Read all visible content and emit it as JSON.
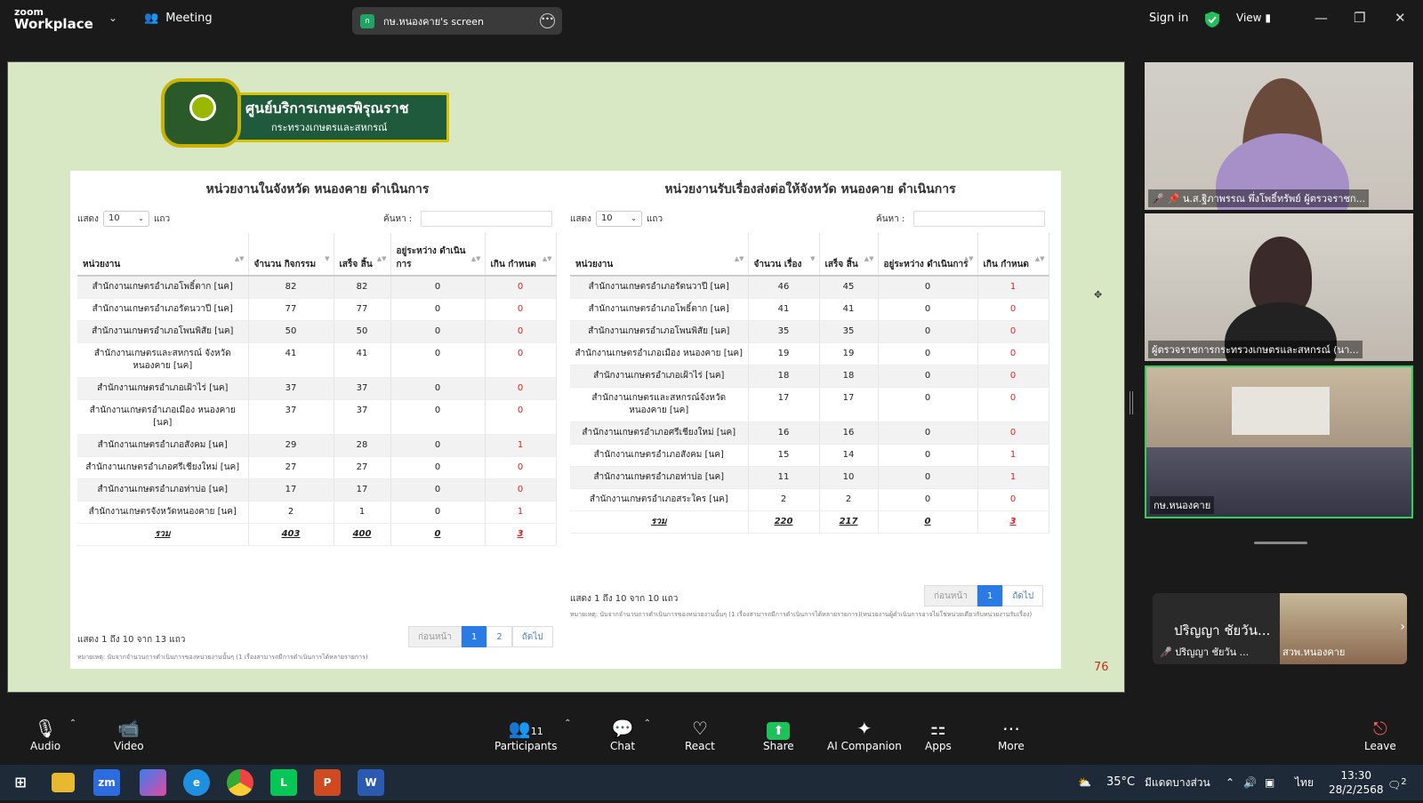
{
  "topbar": {
    "logo_top": "zoom",
    "logo_bottom": "Workplace",
    "meeting_label": "Meeting",
    "screen_avatar": "ก",
    "screen_label": "กษ.หนองคาย's screen",
    "signin_label": "Sign in",
    "view_label": "View"
  },
  "banner": {
    "title": "ศูนย์บริการเกษตรพิรุณราช",
    "subtitle": "กระทรวงเกษตรและสหกรณ์"
  },
  "left_table": {
    "title": "หน่วยงานในจังหวัด หนองคาย ดำเนินการ",
    "show_label": "แสดง",
    "show_value": "10",
    "rows_label": "แถว",
    "search_label": "ค้นหา :",
    "headers": [
      "หน่วยงาน",
      "จำนวน กิจกรรม",
      "เสร็จ สิ้น",
      "อยู่ระหว่าง ดำเนินการ",
      "เกิน กำหนด"
    ],
    "rows": [
      [
        "สำนักงานเกษตรอำเภอโพธิ์ตาก [นค]",
        "82",
        "82",
        "0",
        "0"
      ],
      [
        "สำนักงานเกษตรอำเภอรัตนวาปี [นค]",
        "77",
        "77",
        "0",
        "0"
      ],
      [
        "สำนักงานเกษตรอำเภอโพนพิสัย [นค]",
        "50",
        "50",
        "0",
        "0"
      ],
      [
        "สำนักงานเกษตรและสหกรณ์ จังหวัดหนองคาย [นค]",
        "41",
        "41",
        "0",
        "0"
      ],
      [
        "สำนักงานเกษตรอำเภอเฝ้าไร่ [นค]",
        "37",
        "37",
        "0",
        "0"
      ],
      [
        "สำนักงานเกษตรอำเภอเมือง หนองคาย [นค]",
        "37",
        "37",
        "0",
        "0"
      ],
      [
        "สำนักงานเกษตรอำเภอสังคม [นค]",
        "29",
        "28",
        "0",
        "1"
      ],
      [
        "สำนักงานเกษตรอำเภอศรีเชียงใหม่ [นค]",
        "27",
        "27",
        "0",
        "0"
      ],
      [
        "สำนักงานเกษตรอำเภอท่าบ่อ [นค]",
        "17",
        "17",
        "0",
        "0"
      ],
      [
        "สำนักงานเกษตรจังหวัดหนองคาย [นค]",
        "2",
        "1",
        "0",
        "1"
      ]
    ],
    "total": [
      "รวม",
      "403",
      "400",
      "0",
      "3"
    ],
    "footer": "แสดง 1 ถึง 10 จาก 13 แถว",
    "pager": {
      "prev": "ก่อนหน้า",
      "pages": [
        "1",
        "2"
      ],
      "next": "ถัดไป"
    },
    "note": "หมายเหตุ: นับจากจำนวนการดำเนินการของหน่วยงานนั้นๆ (1 เรื่องสามารถมีการดำเนินการได้หลายรายการ)"
  },
  "right_table": {
    "title": "หน่วยงานรับเรื่องส่งต่อให้จังหวัด หนองคาย ดำเนินการ",
    "show_label": "แสดง",
    "show_value": "10",
    "rows_label": "แถว",
    "search_label": "ค้นหา :",
    "headers": [
      "หน่วยงาน",
      "จำนวน เรื่อง",
      "เสร็จ สิ้น",
      "อยู่ระหว่าง ดำเนินการ",
      "เกิน กำหนด"
    ],
    "rows": [
      [
        "สำนักงานเกษตรอำเภอรัตนวาปี [นค]",
        "46",
        "45",
        "0",
        "1"
      ],
      [
        "สำนักงานเกษตรอำเภอโพธิ์ตาก [นค]",
        "41",
        "41",
        "0",
        "0"
      ],
      [
        "สำนักงานเกษตรอำเภอโพนพิสัย [นค]",
        "35",
        "35",
        "0",
        "0"
      ],
      [
        "สำนักงานเกษตรอำเภอเมือง หนองคาย [นค]",
        "19",
        "19",
        "0",
        "0"
      ],
      [
        "สำนักงานเกษตรอำเภอเฝ้าไร่ [นค]",
        "18",
        "18",
        "0",
        "0"
      ],
      [
        "สำนักงานเกษตรและสหกรณ์จังหวัด หนองคาย [นค]",
        "17",
        "17",
        "0",
        "0"
      ],
      [
        "สำนักงานเกษตรอำเภอศรีเชียงใหม่ [นค]",
        "16",
        "16",
        "0",
        "0"
      ],
      [
        "สำนักงานเกษตรอำเภอสังคม [นค]",
        "15",
        "14",
        "0",
        "1"
      ],
      [
        "สำนักงานเกษตรอำเภอท่าบ่อ [นค]",
        "11",
        "10",
        "0",
        "1"
      ],
      [
        "สำนักงานเกษตรอำเภอสระใคร [นค]",
        "2",
        "2",
        "0",
        "0"
      ]
    ],
    "total": [
      "รวม",
      "220",
      "217",
      "0",
      "3"
    ],
    "footer": "แสดง 1 ถึง 10 จาก 10 แถว",
    "pager": {
      "prev": "ก่อนหน้า",
      "pages": [
        "1"
      ],
      "next": "ถัดไป"
    },
    "note": "หมายเหตุ: นับจากจำนวนการดำเนินการของหน่วยงานนั้นๆ (1 เรื่องสามารถมีการดำเนินการได้หลายรายการ)(หน่วยงานผู้ดำเนินการอาจไม่ใช่หน่วยเดียวกับหน่วยงานรับเรื่อง)"
  },
  "slide_page_number": "76",
  "video_tiles": [
    {
      "label": "น.ส.ฐิภาพรรณ พึ่งโพธิ์ทรัพย์ ผู้ตรวจราชก..."
    },
    {
      "label": "ผู้ตรวจราชการกระทรวงเกษตรและสหกรณ์ (นา..."
    },
    {
      "label": "กษ.หนองคาย"
    }
  ],
  "mini_tile": {
    "name": "ปริญญา ชัยวัน...",
    "sub_label": "ปริญญา ชัยวัน ...",
    "video_label": "สวพ.หนองคาย"
  },
  "toolbar": {
    "audio": "Audio",
    "video": "Video",
    "participants": "Participants",
    "participants_count": "11",
    "chat": "Chat",
    "react": "React",
    "share": "Share",
    "ai": "AI Companion",
    "apps": "Apps",
    "more": "More",
    "leave": "Leave"
  },
  "taskbar": {
    "temperature": "35°C",
    "weather": "มีแดดบางส่วน",
    "lang": "ไทย",
    "time": "13:30",
    "date": "28/2/2568",
    "zoom_icon": "zm",
    "notif_count": "2"
  },
  "colors": {
    "accent_blue": "#2a7be4",
    "overdue_red": "#e02020",
    "slide_bg": "#d8e8c5",
    "active_speaker": "#30d060"
  }
}
